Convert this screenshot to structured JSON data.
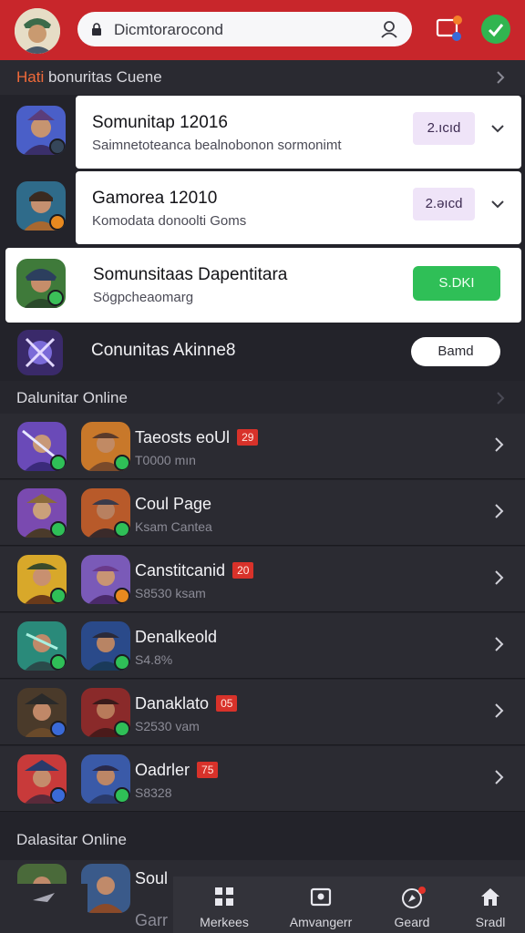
{
  "header": {
    "search_text": "Dicmtorarocond"
  },
  "featured": {
    "section_title_accent": "Hati",
    "section_title_rest": " bonuritas Cuene",
    "cards": [
      {
        "name": "Somunitap 12016",
        "sub": "Saimnetoteanca bealnobonon sormonimt",
        "pill": "2.ıcıd"
      },
      {
        "name": "Gamorea 12010",
        "sub": "Komodata donoolti Goms",
        "pill": "2.əıcd"
      },
      {
        "name": "Somunsitaas Dapentitara",
        "sub": "Sögpcheaomarg",
        "action": "S.DKI"
      }
    ],
    "plain_row": {
      "name": "Conunitas Akinne8",
      "button": "Bamd"
    }
  },
  "online": {
    "section_title": "Dalunitar Online",
    "rows": [
      {
        "name": "Taeosts eoUl",
        "tag": "29",
        "sub": "T0000 mın"
      },
      {
        "name": "Coul Page",
        "tag": "",
        "sub": "Ksam Cantea"
      },
      {
        "name": "Canstitcanid",
        "tag": "20",
        "sub": "S8530 ksam"
      },
      {
        "name": "Denalkeold",
        "tag": "",
        "sub": "S4.8%"
      },
      {
        "name": "Danaklato",
        "tag": "05",
        "sub": "S2530 vam"
      },
      {
        "name": "Oadrler",
        "tag": "75",
        "sub": "S8328"
      }
    ]
  },
  "second_section": {
    "title": "Dalasitar Online",
    "rows": [
      {
        "name": "Soul"
      },
      {
        "name": "Garr"
      }
    ]
  },
  "bottom_nav": {
    "items": [
      {
        "label": "Merkees",
        "icon": "grid-icon"
      },
      {
        "label": "Amvangerr",
        "icon": "chest-icon"
      },
      {
        "label": "Geard",
        "icon": "compass-icon"
      },
      {
        "label": "Sradl",
        "icon": "home-icon"
      }
    ]
  },
  "colors": {
    "header": "#c8262b",
    "background": "#23232a",
    "accent_green": "#2fbf57",
    "tag_red": "#d8322a"
  }
}
